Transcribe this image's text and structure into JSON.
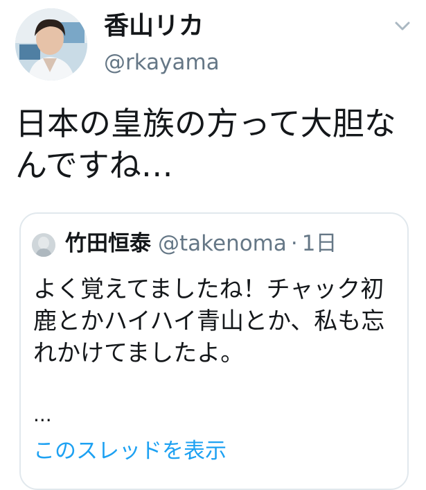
{
  "author": {
    "display_name": "香山リカ",
    "handle": "@rkayama",
    "avatar_icon": "profile-photo"
  },
  "tweet": {
    "text": "日本の皇族の方って大胆なんですね…"
  },
  "quoted_tweet": {
    "display_name": "竹田恒泰",
    "handle": "@takenoma",
    "separator": "·",
    "time": "1日",
    "text": "よく覚えてましたね！チャック初鹿とかハイハイ青山とか、私も忘れかけてましたよ。",
    "more_indicator": "...",
    "thread_link": "このスレッドを表示"
  },
  "colors": {
    "text": "#14171a",
    "secondary": "#657786",
    "link": "#1da1f2",
    "border": "#e1e8ed"
  },
  "icons": {
    "menu": "chevron-down-icon"
  }
}
